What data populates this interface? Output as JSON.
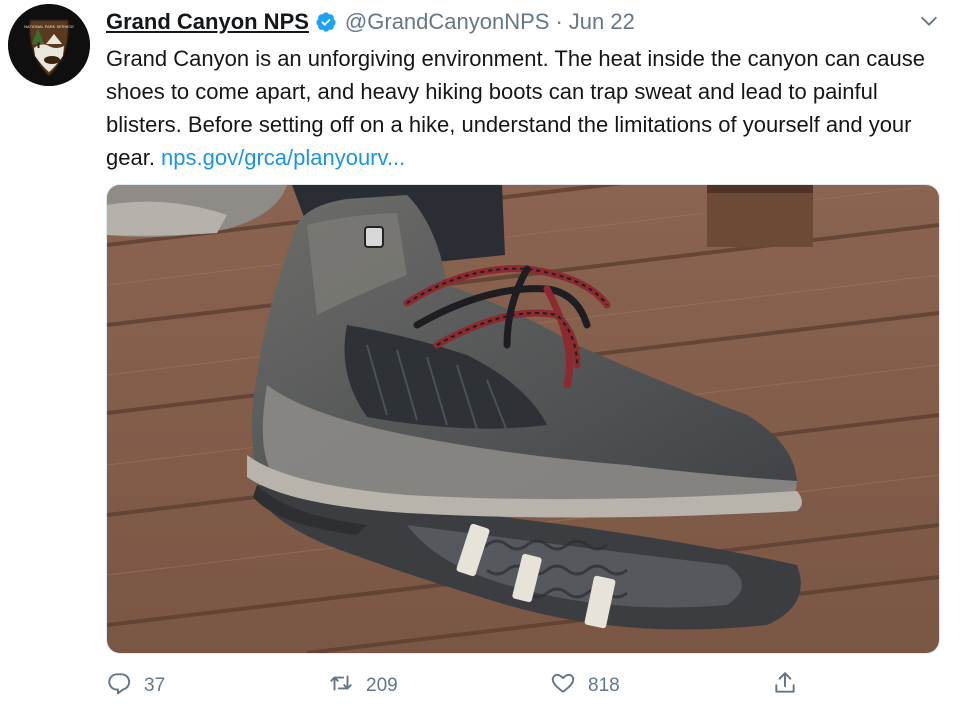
{
  "account": {
    "display_name": "Grand Canyon NPS",
    "handle": "@GrandCanyonNPS",
    "separator": "·",
    "date": "Jun 22",
    "avatar_icon": "nps-arrowhead-logo",
    "avatar_text": "NATIONAL PARK SERVICE",
    "verified_icon": "verified-badge-icon",
    "verified_color": "#1da1f2"
  },
  "tweet": {
    "text": "Grand Canyon is an unforgiving environment. The heat inside the canyon can cause shoes to come apart, and heavy hiking boots can trap sweat and lead to painful blisters. Before setting off on a hike, understand the limitations of yourself and your gear.",
    "link": "nps.gov/grca/planyourv..."
  },
  "media": {
    "description_icon": "photo-worn-hiking-boot-with-detached-sole"
  },
  "actions": {
    "reply_count": "37",
    "retweet_count": "209",
    "like_count": "818",
    "icons": [
      "reply-icon",
      "retweet-icon",
      "like-icon",
      "share-icon"
    ]
  },
  "colors": {
    "text": "#14171a",
    "secondary": "#657786",
    "link": "#1b95e0"
  }
}
